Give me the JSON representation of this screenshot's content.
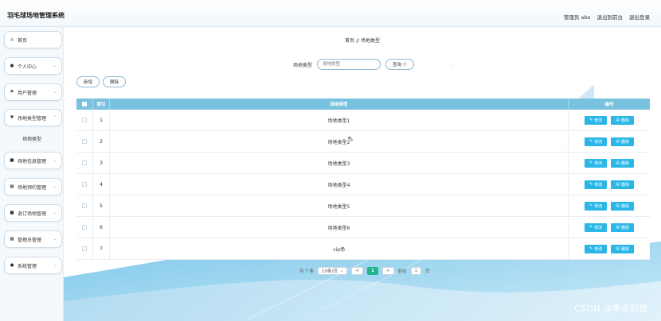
{
  "header": {
    "title": "羽毛球场地管理系统",
    "admin_label": "管理员 abo",
    "back_label": "退出到前台",
    "logout_label": "退出登录"
  },
  "sidebar": {
    "items": [
      {
        "label": "首页",
        "icon": "home-icon",
        "glyph": "⌂"
      },
      {
        "label": "个人中心",
        "icon": "user-icon",
        "glyph": "●"
      },
      {
        "label": "用户管理",
        "icon": "flag-icon",
        "glyph": "⚑"
      },
      {
        "label": "场地类型管理",
        "icon": "bookmark-icon",
        "glyph": "▼"
      },
      {
        "label": "场地信息管理",
        "icon": "card-icon",
        "glyph": "■"
      },
      {
        "label": "场地预约管理",
        "icon": "grid-icon",
        "glyph": "▦"
      },
      {
        "label": "退订场地管理",
        "icon": "lock-icon",
        "glyph": "■"
      },
      {
        "label": "管理员管理",
        "icon": "grid-icon",
        "glyph": "▦"
      },
      {
        "label": "系统管理",
        "icon": "user-icon",
        "glyph": "●"
      }
    ],
    "subitem": "场地类型"
  },
  "breadcrumb": {
    "home": "首页",
    "sep": "//",
    "current": "场地类型"
  },
  "search": {
    "label": "场地类型",
    "placeholder": "场地类型",
    "button": "查询"
  },
  "actions": {
    "add": "新增",
    "delete": "删除"
  },
  "table": {
    "headers": {
      "index": "索引",
      "type": "场地类型",
      "ops": "操作"
    },
    "edit_label": "修改",
    "delete_label": "删除",
    "rows": [
      {
        "index": "1",
        "type": "场地类型1"
      },
      {
        "index": "2",
        "type": "场地类型2"
      },
      {
        "index": "3",
        "type": "场地类型3"
      },
      {
        "index": "4",
        "type": "场地类型4"
      },
      {
        "index": "5",
        "type": "场地类型5"
      },
      {
        "index": "6",
        "type": "场地类型6"
      },
      {
        "index": "7",
        "type": "vip场"
      }
    ]
  },
  "pager": {
    "total": "共 7 条",
    "page_size": "10条/页",
    "prev": "<",
    "current": "1",
    "next": ">",
    "goto_label": "前往",
    "goto_value": "1",
    "page_suffix": "页"
  },
  "watermark": "CSDN @李会科技",
  "colors": {
    "header_bg": "#79c2df",
    "op_button": "#2ab6e6",
    "pager_active": "#1fb58f"
  }
}
